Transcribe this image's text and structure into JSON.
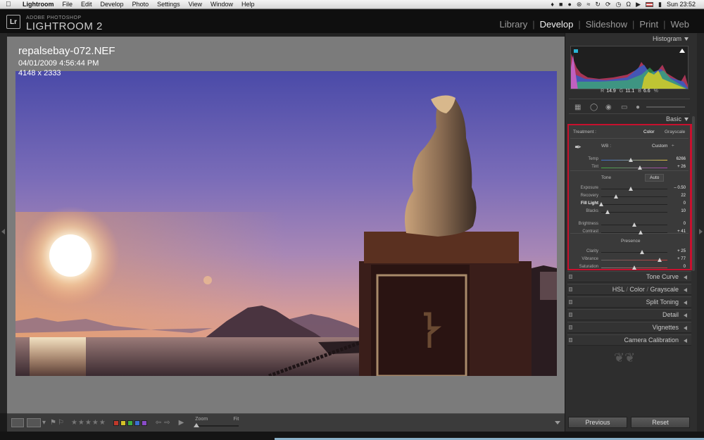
{
  "menubar": {
    "app": "Lightroom",
    "items": [
      "File",
      "Edit",
      "Develop",
      "Photo",
      "Settings",
      "View",
      "Window",
      "Help"
    ],
    "clock": "Sun 23:52"
  },
  "header": {
    "brand_sub": "ADOBE PHOTOSHOP",
    "brand": "LIGHTROOM 2",
    "logo": "Lr",
    "modules": [
      "Library",
      "Develop",
      "Slideshow",
      "Print",
      "Web"
    ],
    "active_module": "Develop"
  },
  "photo_info": {
    "filename": "repalsebay-072.NEF",
    "datetime": "04/01/2009 4:56:44 PM",
    "dimensions": "4148 x 2333"
  },
  "histogram": {
    "title": "Histogram",
    "r_label": "R",
    "r_value": "14.9",
    "g_label": "G",
    "g_value": "11.1",
    "b_label": "B",
    "b_value": "6.6",
    "pct": "%"
  },
  "basic": {
    "title": "Basic",
    "treatment_label": "Treatment :",
    "treatment_color": "Color",
    "treatment_gray": "Grayscale",
    "wb_label": "WB :",
    "wb_value": "Custom",
    "wb_arrow": "÷",
    "tone_label": "Tone",
    "auto_label": "Auto",
    "presence_label": "Presence",
    "sliders": [
      {
        "label": "Temp",
        "value": "6266",
        "pos": 0.45
      },
      {
        "label": "Tint",
        "value": "+ 26",
        "pos": 0.58
      },
      {
        "label": "Exposure",
        "value": "– 0.50",
        "pos": 0.45
      },
      {
        "label": "Recovery",
        "value": "22",
        "pos": 0.22
      },
      {
        "label": "Fill Light",
        "value": "0",
        "pos": 0.0
      },
      {
        "label": "Blacks",
        "value": "10",
        "pos": 0.1
      },
      {
        "label": "Brightness",
        "value": "0",
        "pos": 0.5
      },
      {
        "label": "Contrast",
        "value": "+ 41",
        "pos": 0.6
      },
      {
        "label": "Clarity",
        "value": "+ 25",
        "pos": 0.62
      },
      {
        "label": "Vibrance",
        "value": "+ 77",
        "pos": 0.88
      },
      {
        "label": "Saturation",
        "value": "0",
        "pos": 0.5
      }
    ]
  },
  "panels": {
    "tone_curve": "Tone Curve",
    "hsl": "HSL",
    "color": "Color",
    "grayscale": "Grayscale",
    "split_toning": "Split Toning",
    "detail": "Detail",
    "vignettes": "Vignettes",
    "camera_calibration": "Camera Calibration",
    "slash": "/"
  },
  "toolbar": {
    "zoom_label": "Zoom",
    "fit_label": "Fit",
    "stars": "★★★★★"
  },
  "buttons": {
    "previous": "Previous",
    "reset": "Reset"
  },
  "colors": {
    "highlight_border": "#c8102e",
    "label_red": "#c0392b",
    "label_yellow": "#d4c228",
    "label_green": "#3fae3f",
    "label_blue": "#3a6fd0",
    "label_purple": "#8a4cc7"
  }
}
